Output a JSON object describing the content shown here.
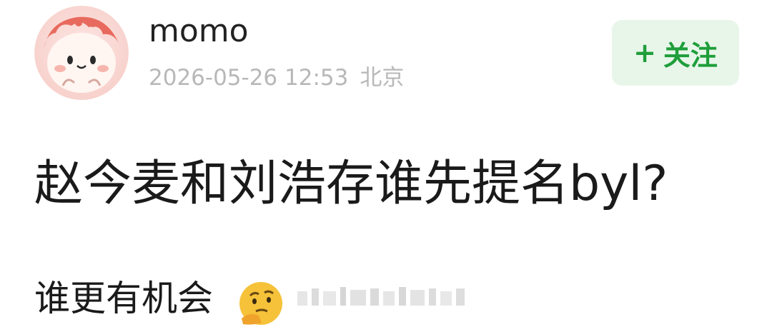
{
  "post": {
    "author": {
      "name": "momo"
    },
    "timestamp": "2026-05-26 12:53",
    "location": "北京",
    "follow_button": {
      "plus": "+",
      "label": "关注"
    },
    "content_line1": "赵今麦和刘浩存谁先提名byl?",
    "content_line2": "谁更有机会"
  },
  "colors": {
    "follow_bg": "#e8f6ea",
    "follow_text": "#1f9e3a",
    "meta_text": "#b8b8b8"
  },
  "icons": [
    "avatar-image",
    "thinking-face-emoji"
  ]
}
